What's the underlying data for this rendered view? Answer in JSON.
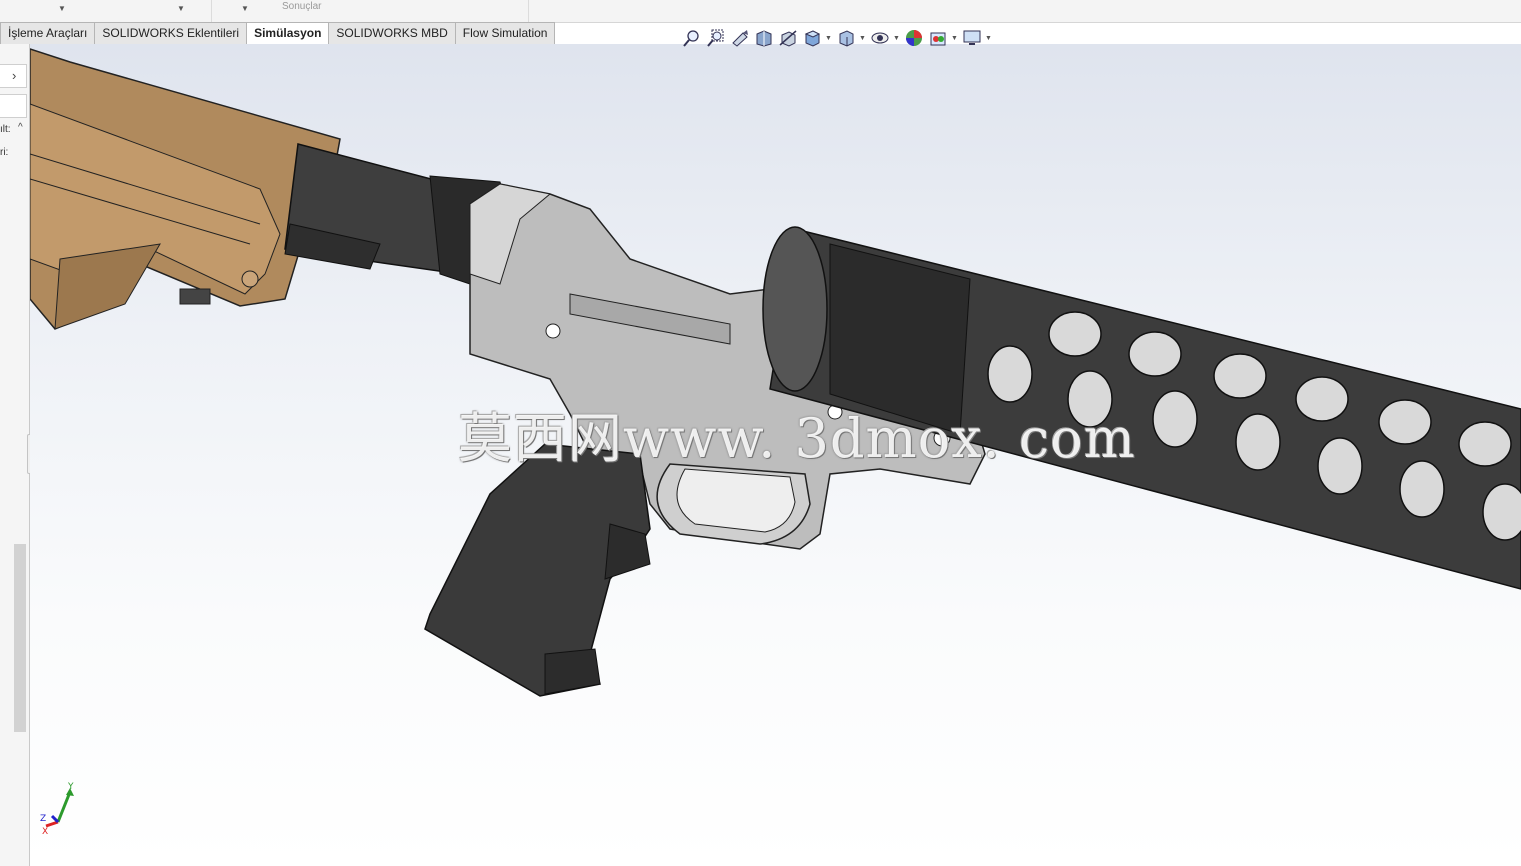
{
  "ribbon": {
    "results_label": "Sonuçlar"
  },
  "tabs": [
    {
      "label": "İşleme Araçları",
      "active": false
    },
    {
      "label": "SOLIDWORKS Eklentileri",
      "active": false
    },
    {
      "label": "Simülasyon",
      "active": true
    },
    {
      "label": "SOLIDWORKS MBD",
      "active": false
    },
    {
      "label": "Flow Simulation",
      "active": false
    }
  ],
  "left_panel": {
    "expand_chevron": "›",
    "row1_text": "ılt:",
    "row2_text": "ri:",
    "collapse_arrow": "^"
  },
  "heads_up_toolbar": [
    "zoom-to-fit-icon",
    "zoom-to-area-icon",
    "previous-view-icon",
    "section-view-icon",
    "dynamic-annotation-icon",
    "view-orientation-icon",
    "display-style-icon",
    "hide-show-items-icon",
    "edit-appearance-icon",
    "apply-scene-icon",
    "view-settings-icon"
  ],
  "watermark": "莫西网www. 3dmox. com",
  "triad": {
    "x": "X",
    "y": "Y",
    "z": "Z"
  },
  "colors": {
    "stock": "#b28e63",
    "receiver": "#bdbdbd",
    "dark_parts": "#3e3e3e"
  }
}
